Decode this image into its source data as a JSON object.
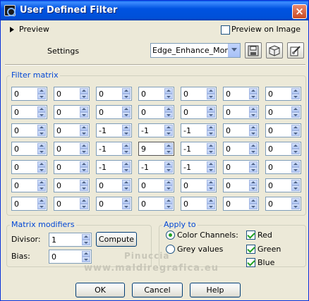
{
  "window": {
    "title": "User Defined Filter",
    "close_glyph": "×"
  },
  "preview": {
    "toggle_label": "Preview",
    "on_image_label": "Preview on Image",
    "on_image_checked": false
  },
  "settings": {
    "label": "Settings",
    "preset_value": "Edge_Enhance_More",
    "icons": [
      "save-preset-icon",
      "reset-cube-icon",
      "edit-preset-icon"
    ]
  },
  "filter_matrix": {
    "title": "Filter matrix",
    "rows": [
      [
        "0",
        "0",
        "0",
        "0",
        "0",
        "0",
        "0"
      ],
      [
        "0",
        "0",
        "0",
        "0",
        "0",
        "0",
        "0"
      ],
      [
        "0",
        "0",
        "-1",
        "-1",
        "-1",
        "0",
        "0"
      ],
      [
        "0",
        "0",
        "-1",
        "9",
        "-1",
        "0",
        "0"
      ],
      [
        "0",
        "0",
        "-1",
        "-1",
        "-1",
        "0",
        "0"
      ],
      [
        "0",
        "0",
        "0",
        "0",
        "0",
        "0",
        "0"
      ],
      [
        "0",
        "0",
        "0",
        "0",
        "0",
        "0",
        "0"
      ]
    ]
  },
  "matrix_modifiers": {
    "title": "Matrix modifiers",
    "divisor_label": "Divisor:",
    "divisor_value": "1",
    "compute_label": "Compute",
    "bias_label": "Bias:",
    "bias_value": "0"
  },
  "apply_to": {
    "title": "Apply to",
    "color_channels_label": "Color Channels:",
    "grey_values_label": "Grey values",
    "selected": "color_channels",
    "channels": [
      {
        "label": "Red",
        "checked": true
      },
      {
        "label": "Green",
        "checked": true
      },
      {
        "label": "Blue",
        "checked": true
      }
    ]
  },
  "watermark": {
    "line1": "Pinuccia",
    "line2": "www.maldiregrafica.eu"
  },
  "buttons": {
    "ok": "OK",
    "cancel": "Cancel",
    "help": "Help"
  }
}
